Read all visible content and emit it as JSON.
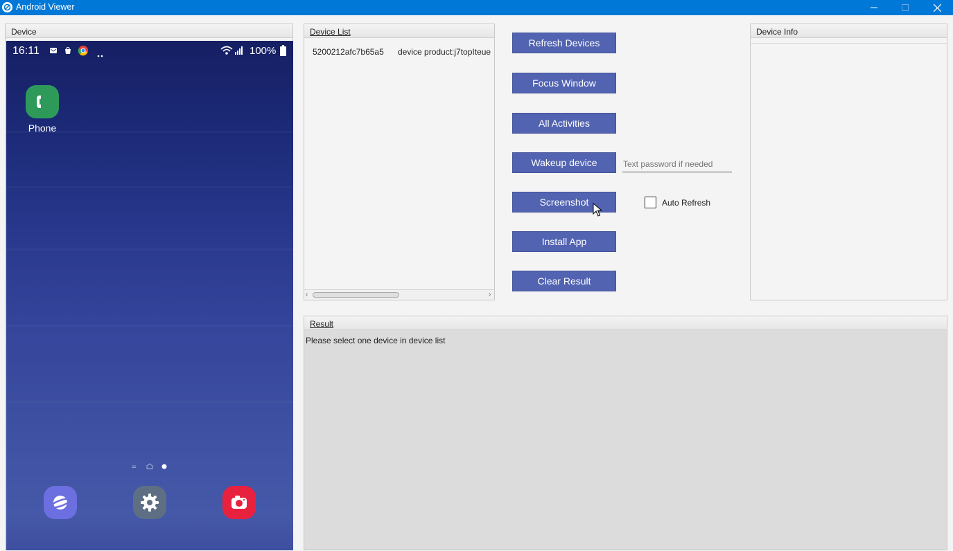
{
  "window": {
    "title": "Android Viewer"
  },
  "device_panel": {
    "header": "Device",
    "status_bar": {
      "time": "16:11",
      "battery": "100%"
    },
    "home_apps": [
      {
        "label": "Phone",
        "icon": "phone-icon",
        "color": "#2e9a5a"
      }
    ],
    "dock_apps": [
      {
        "icon": "internet-icon",
        "color": "#6b6fe0"
      },
      {
        "icon": "settings-icon",
        "color": "#5e6f84"
      },
      {
        "icon": "camera-icon",
        "color": "#e8213f"
      }
    ]
  },
  "device_list": {
    "header": "Device List",
    "rows": [
      {
        "serial": "5200212afc7b65a5",
        "description": "device product:j7topIteue"
      }
    ]
  },
  "actions": {
    "refresh_devices": "Refresh Devices",
    "focus_window": "Focus Window",
    "all_activities": "All Activities",
    "wakeup_device": "Wakeup device",
    "screenshot": "Screenshot",
    "install_app": "Install App",
    "clear_result": "Clear Result",
    "password_placeholder": "Text password if needed",
    "auto_refresh_label": "Auto Refresh",
    "auto_refresh_checked": false
  },
  "device_info": {
    "header": "Device Info"
  },
  "result": {
    "header": "Result",
    "text": "Please select one device in device list"
  },
  "colors": {
    "titlebar": "#0078d7",
    "button": "#5263b1",
    "result_bg": "#dcdcdc"
  }
}
